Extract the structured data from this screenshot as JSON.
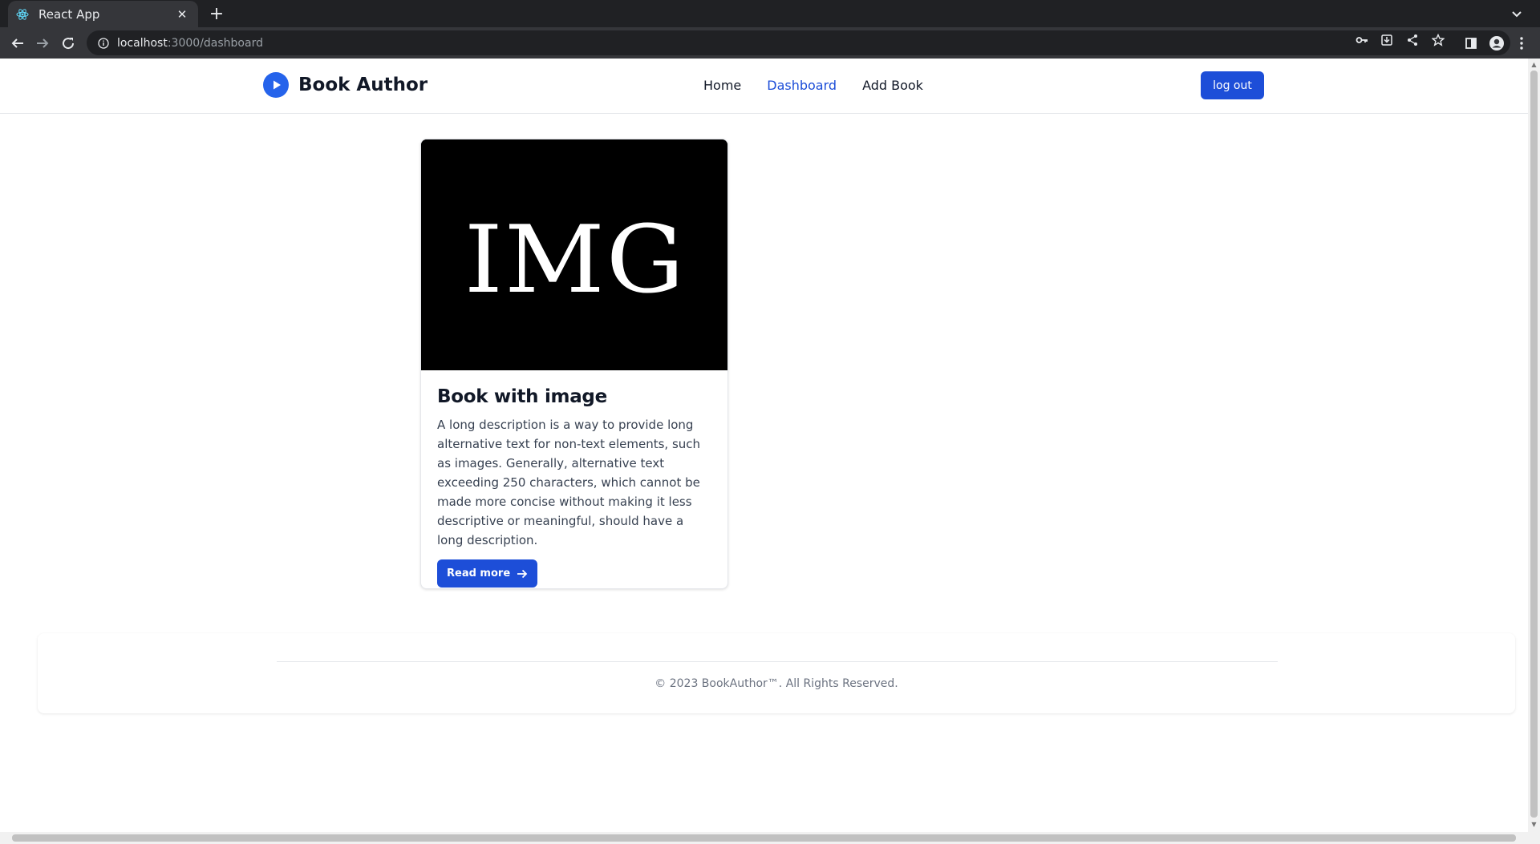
{
  "browser": {
    "tab": {
      "title": "React App",
      "favicon": "react-icon"
    },
    "url": {
      "host": "localhost",
      "path": ":3000/dashboard"
    },
    "icons": [
      "back-icon",
      "forward-icon",
      "reload-icon",
      "info-icon",
      "key-icon",
      "install-icon",
      "share-icon",
      "star-icon",
      "sidepanel-icon",
      "profile-icon",
      "menu-icon"
    ]
  },
  "navbar": {
    "brand": "Book Author",
    "links": [
      {
        "label": "Home",
        "active": false
      },
      {
        "label": "Dashboard",
        "active": true
      },
      {
        "label": "Add Book",
        "active": false
      }
    ],
    "logout_label": "log out"
  },
  "book": {
    "image_label": "IMG",
    "title": "Book with image",
    "description": "A long description is a way to provide long alternative text for non-text elements, such as images. Generally, alternative text exceeding 250 characters, which cannot be made more concise without making it less descriptive or meaningful, should have a long description.",
    "read_more_label": "Read more"
  },
  "footer": {
    "text": "© 2023 BookAuthor™. All Rights Reserved."
  },
  "colors": {
    "accent": "#1d4ed8",
    "text": "#111827",
    "muted": "#6b7280"
  }
}
